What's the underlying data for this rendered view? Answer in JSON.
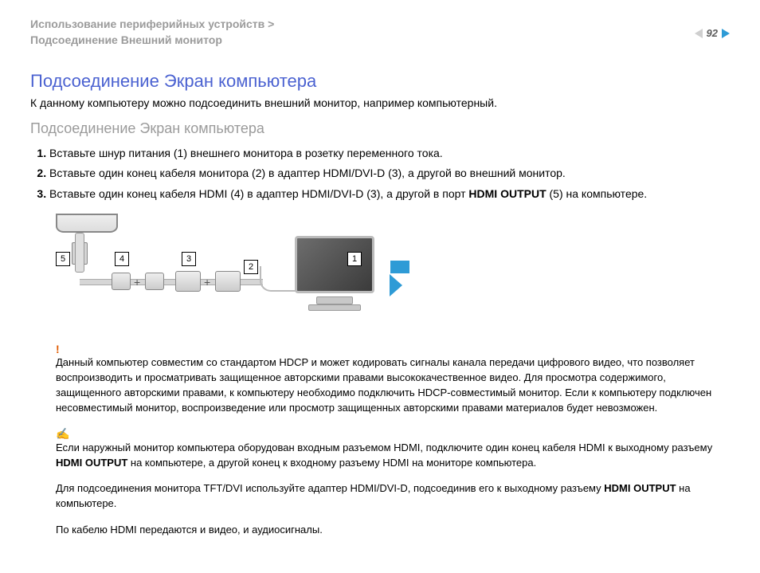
{
  "header": {
    "breadcrumb_line1": "Использование периферийных устройств >",
    "breadcrumb_line2": "Подсоединение Внешний монитор",
    "page_number": "92"
  },
  "title": "Подсоединение Экран компьютера",
  "intro": "К данному компьютеру можно подсоединить внешний монитор, например компьютерный.",
  "subtitle": "Подсоединение Экран компьютера",
  "steps": [
    "Вставьте шнур питания (1) внешнего монитора в розетку переменного тока.",
    "Вставьте один конец кабеля монитора (2) в адаптер HDMI/DVI-D (3), а другой во внешний монитор.",
    {
      "pre": "Вставьте один конец кабеля HDMI (4) в адаптер HDMI/DVI-D (3), а другой в порт ",
      "bold": "HDMI OUTPUT",
      "post": " (5) на компьютере."
    }
  ],
  "diagram_labels": {
    "l1": "1",
    "l2": "2",
    "l3": "3",
    "l4": "4",
    "l5": "5"
  },
  "warn_mark": "!",
  "note_mark": "✍",
  "warning": "Данный компьютер совместим со стандартом HDCP и может кодировать сигналы канала передачи цифрового видео, что позволяет воспроизводить и просматривать защищенное авторскими правами высококачественное видео. Для просмотра содержимого, защищенного авторскими правами, к компьютеру необходимо подключить HDCP-совместимый монитор. Если к компьютеру подключен несовместимый монитор, воспроизведение или просмотр защищенных авторскими правами материалов будет невозможен.",
  "note1": {
    "pre": "Если наружный монитор компьютера оборудован входным разъемом HDMI, подключите один конец кабеля HDMI к выходному разъему ",
    "b1": "HDMI OUTPUT",
    "mid": " на компьютере, а другой конец к входному разъему HDMI на мониторе компьютера."
  },
  "note2": {
    "pre": "Для подсоединения монитора TFT/DVI используйте адаптер HDMI/DVI-D, подсоединив его к выходному разъему ",
    "b1": "HDMI OUTPUT",
    "post": " на компьютере."
  },
  "note3": "По кабелю HDMI передаются и видео, и аудиосигналы."
}
